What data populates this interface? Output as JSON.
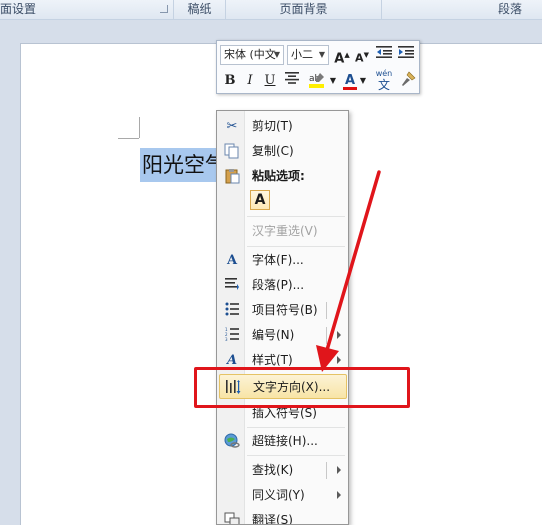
{
  "ribbon": {
    "groups": [
      "页面设置",
      "稿纸",
      "页面背景",
      "段落"
    ]
  },
  "document": {
    "selected_text": "阳光空气"
  },
  "mini_toolbar": {
    "font_name": "宋体 (中文",
    "font_size": "小二",
    "grow_font": "A",
    "shrink_font": "A",
    "bold": "B",
    "italic": "I",
    "underline": "U",
    "font_color": "A",
    "phonetic_top": "wén",
    "phonetic_bottom": "文"
  },
  "context_menu": {
    "cut": "剪切(T)",
    "copy": "复制(C)",
    "paste_options_header": "粘贴选项:",
    "paste_keep_text": "A",
    "reconvert": "汉字重选(V)",
    "font": "字体(F)...",
    "paragraph": "段落(P)...",
    "bullets": "项目符号(B)",
    "numbering": "编号(N)",
    "styles": "样式(T)",
    "text_direction": "文字方向(X)...",
    "insert_symbol": "插入符号(S)",
    "hyperlink": "超链接(H)...",
    "lookup": "查找(K)",
    "synonyms": "同义词(Y)",
    "translate": "翻译(S)"
  },
  "annotation": {
    "color": "#e0151b"
  }
}
